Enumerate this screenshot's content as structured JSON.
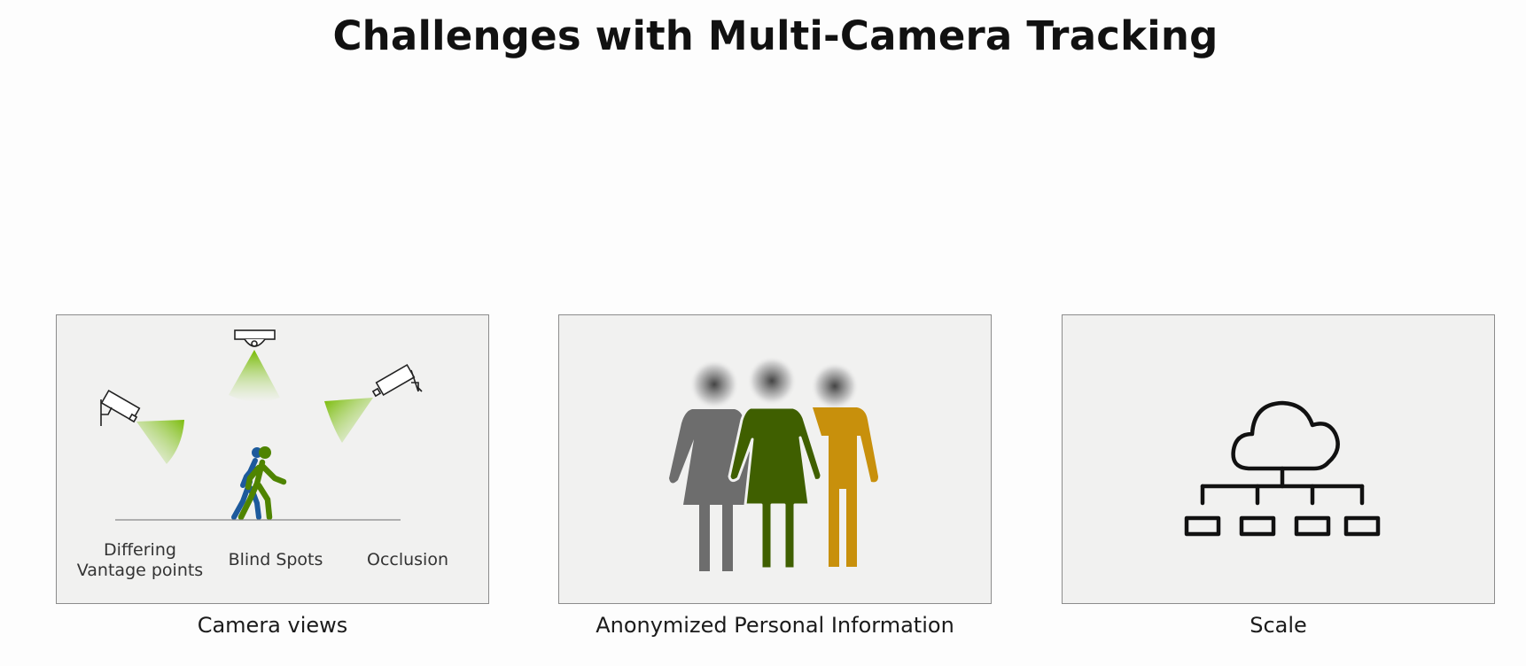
{
  "title": "Challenges with Multi-Camera Tracking",
  "panels": [
    {
      "caption": "Camera views",
      "labels": {
        "vantage": "Differing Vantage points",
        "blind": "Blind Spots",
        "occlusion": "Occlusion"
      },
      "icons": [
        "security-camera-icon",
        "ceiling-camera-icon",
        "walking-people-icon"
      ]
    },
    {
      "caption": "Anonymized Personal Information",
      "icons": [
        "blurred-people-icon"
      ]
    },
    {
      "caption": "Scale",
      "icons": [
        "cloud-network-icon"
      ]
    }
  ],
  "colors": {
    "accent_green": "#76b900",
    "dark_green": "#3f5f00",
    "gray_figure": "#707070",
    "gold_figure": "#c8900c",
    "blue_figure": "#1d5a9c",
    "panel_bg": "#f1f1f0"
  }
}
